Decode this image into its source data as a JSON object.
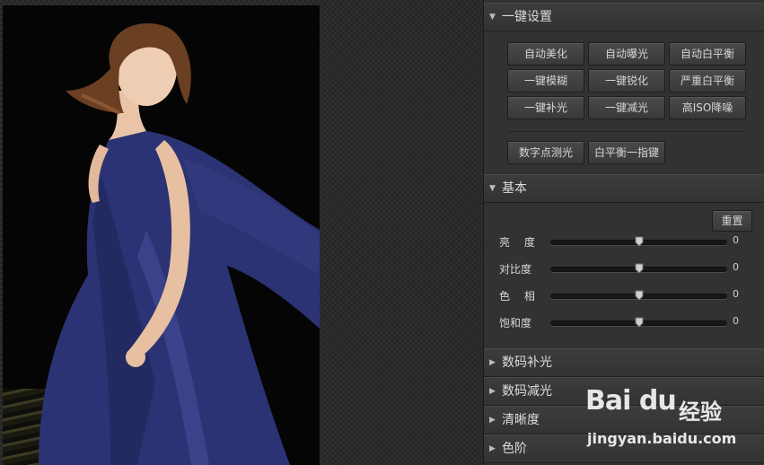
{
  "sections": {
    "one_click": {
      "title": "一键设置",
      "buttons": [
        "自动美化",
        "自动曝光",
        "自动白平衡",
        "一键模糊",
        "一键锐化",
        "严重白平衡",
        "一键补光",
        "一键减光",
        "高ISO降噪"
      ],
      "extra_buttons": [
        "数字点测光",
        "白平衡一指键"
      ]
    },
    "basic": {
      "title": "基本",
      "reset_label": "重置",
      "sliders": [
        {
          "label": "亮　 度",
          "value": "0"
        },
        {
          "label": "对比度",
          "value": "0"
        },
        {
          "label": "色　 相",
          "value": "0"
        },
        {
          "label": "饱和度",
          "value": "0"
        }
      ]
    },
    "collapsed": [
      "数码补光",
      "数码减光",
      "清晰度",
      "色阶"
    ]
  },
  "watermark": {
    "brand": "Bai du",
    "cn": "经验",
    "url": "jingyan.baidu.com"
  },
  "colors": {
    "panel_bg": "#323232",
    "header_bg": "#383838",
    "button_bg": "#434343",
    "dress": "#2c3374"
  }
}
